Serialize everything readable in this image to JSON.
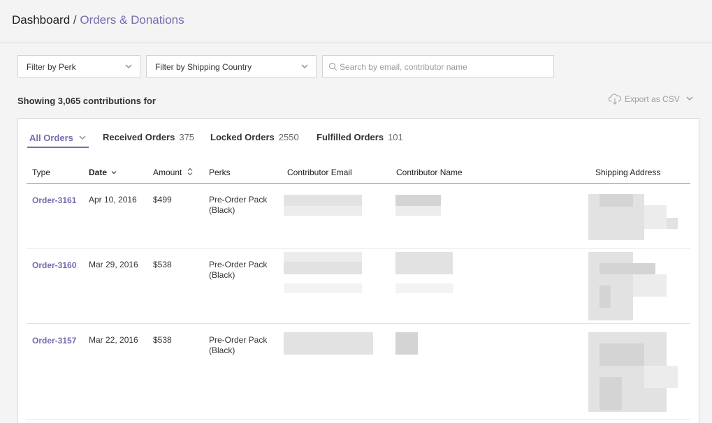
{
  "breadcrumb": {
    "root": "Dashboard",
    "separator": " / ",
    "current": "Orders & Donations"
  },
  "filters": {
    "perk_label": "Filter by Perk",
    "country_label": "Filter by Shipping Country",
    "search_placeholder": "Search by email, contributor name"
  },
  "summary": {
    "showing_text": "Showing 3,065 contributions for"
  },
  "export": {
    "label": "Export as CSV"
  },
  "tabs": [
    {
      "label": "All Orders",
      "count": ""
    },
    {
      "label": "Received Orders",
      "count": "375"
    },
    {
      "label": "Locked Orders",
      "count": "2550"
    },
    {
      "label": "Fulfilled Orders",
      "count": "101"
    }
  ],
  "table": {
    "columns": [
      "Type",
      "Date",
      "Amount",
      "Perks",
      "Contributor Email",
      "Contributor Name",
      "Shipping Address"
    ],
    "rows": [
      {
        "id": "Order-3161",
        "date": "Apr 10, 2016",
        "amount": "$499",
        "perk_line1": "Pre-Order Pack",
        "perk_line2": "(Black)"
      },
      {
        "id": "Order-3160",
        "date": "Mar 29, 2016",
        "amount": "$538",
        "perk_line1": "Pre-Order Pack",
        "perk_line2": "(Black)"
      },
      {
        "id": "Order-3157",
        "date": "Mar 22, 2016",
        "amount": "$538",
        "perk_line1": "Pre-Order Pack",
        "perk_line2": "(Black)"
      }
    ]
  },
  "colors": {
    "accent": "#7a6ab0",
    "background": "#f4f4f4",
    "panel": "#ffffff"
  },
  "icons": [
    "chevron-down-icon",
    "search-icon",
    "cloud-download-icon",
    "sort-desc-icon",
    "sort-both-icon"
  ]
}
